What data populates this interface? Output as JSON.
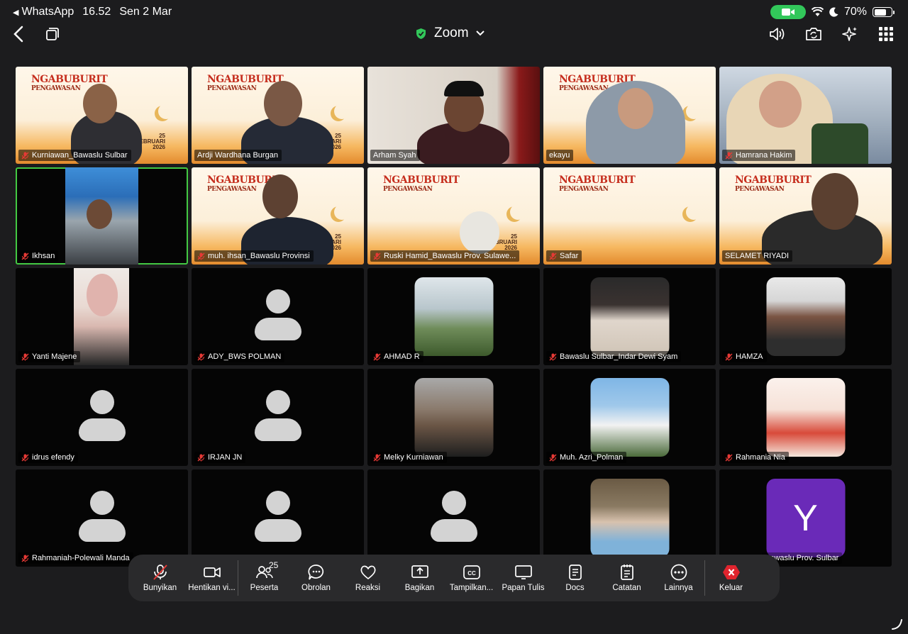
{
  "status": {
    "app": "WhatsApp",
    "time": "16.52",
    "date": "Sen 2 Mar",
    "battery": "70%",
    "battery_level": 0.7
  },
  "nav": {
    "title": "Zoom",
    "accent": "#32c75a"
  },
  "banner": {
    "title": "NGABUBURIT",
    "subtitle": "PENGAWASAN",
    "date_day": "25",
    "date_month": "FEBRUARI",
    "date_year": "2026"
  },
  "tiles": [
    {
      "name": "Kurniawan_Bawaslu Sulbar",
      "muted": true
    },
    {
      "name": "Ardji Wardhana Burgan",
      "muted": false
    },
    {
      "name": "Arham Syah",
      "muted": false
    },
    {
      "name": "ekayu",
      "muted": false
    },
    {
      "name": "Hamrana Hakim",
      "muted": true
    },
    {
      "name": "Ikhsan",
      "muted": true
    },
    {
      "name": "muh. ihsan_Bawaslu Provinsi",
      "muted": true
    },
    {
      "name": "Ruski Hamid_Bawaslu Prov. Sulawe...",
      "muted": true
    },
    {
      "name": "Safar",
      "muted": true
    },
    {
      "name": "SELAMET RIYADI",
      "muted": false
    },
    {
      "name": "Yanti Majene",
      "muted": true
    },
    {
      "name": "ADY_BWS POLMAN",
      "muted": true
    },
    {
      "name": "AHMAD R",
      "muted": true
    },
    {
      "name": "Bawaslu Sulbar_Indar Dewi Syam",
      "muted": true
    },
    {
      "name": "HAMZA",
      "muted": true
    },
    {
      "name": "idrus efendy",
      "muted": true
    },
    {
      "name": "IRJAN JN",
      "muted": true
    },
    {
      "name": "Melky Kurniawan",
      "muted": true
    },
    {
      "name": "Muh. Azri_Polman",
      "muted": true
    },
    {
      "name": "Rahmania Nia",
      "muted": true
    },
    {
      "name": "Rahmaniah-Polewali Manda",
      "muted": true
    },
    {
      "name": "",
      "muted": false
    },
    {
      "name": "",
      "muted": false
    },
    {
      "name": "",
      "muted": false
    },
    {
      "name": "Bawaslu Prov. Sulbar",
      "muted": false,
      "avatar_letter": "Y"
    }
  ],
  "toolbar": {
    "unmute": "Bunyikan",
    "stop_video": "Hentikan vi...",
    "participants": "Peserta",
    "participants_count": "25",
    "chat": "Obrolan",
    "reactions": "Reaksi",
    "share": "Bagikan",
    "captions": "Tampilkan...",
    "whiteboard": "Papan Tulis",
    "docs": "Docs",
    "notes": "Catatan",
    "more": "Lainnya",
    "leave": "Keluar"
  }
}
